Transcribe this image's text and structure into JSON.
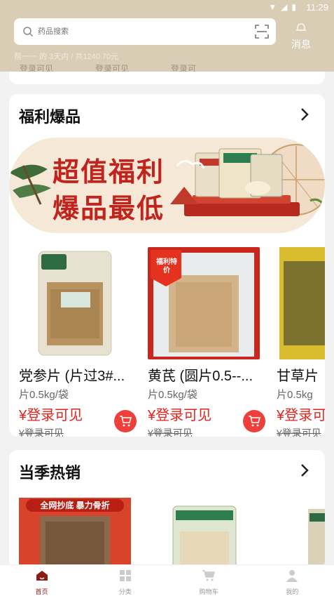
{
  "status_bar": {
    "time": "11:29"
  },
  "header": {
    "search_placeholder": "药品搜索",
    "message_label": "消息",
    "ghost_text": "帮一一 的    3天内 / 共1240.70元",
    "ghost_items": [
      "登录可见",
      "登录可见",
      "登录可"
    ]
  },
  "section1": {
    "title": "福利爆品",
    "banner": {
      "line1": "超值福利",
      "line2": "爆品最低"
    },
    "products": [
      {
        "name": "党参片 (片过3#...",
        "spec": "片0.5kg/袋",
        "price": "¥登录可见",
        "old_price": "¥登录可见",
        "badge": ""
      },
      {
        "name": "黄芪 (圆片0.5--...",
        "spec": "片0.5kg/袋",
        "price": "¥登录可见",
        "old_price": "¥登录可见",
        "badge": "福利特价"
      },
      {
        "name": "甘草片",
        "spec": "片0.5kg",
        "price": "¥登录可",
        "old_price": "¥登录可见",
        "badge": ""
      }
    ]
  },
  "section2": {
    "title": "当季热销",
    "promo_text": "全网抄底 暴力骨折"
  },
  "tabbar": {
    "tabs": [
      {
        "label": "首页",
        "icon": "home-icon"
      },
      {
        "label": "分类",
        "icon": "category-icon"
      },
      {
        "label": "购物车",
        "icon": "cart-icon"
      },
      {
        "label": "我的",
        "icon": "user-icon"
      }
    ]
  },
  "colors": {
    "accent": "#e4231b",
    "header_bg": "#d9cdb6",
    "banner_bg": "#f5e8d7"
  }
}
